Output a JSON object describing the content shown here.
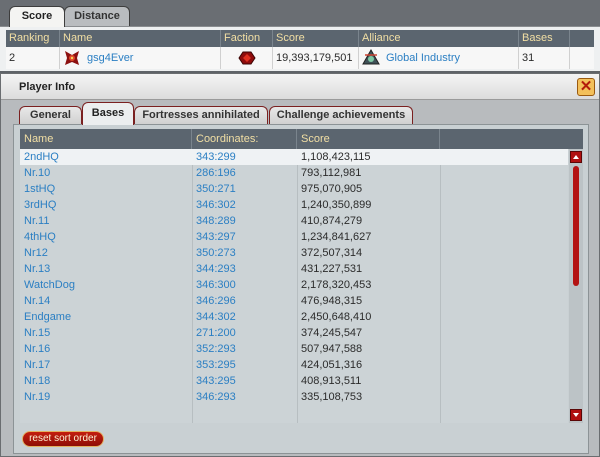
{
  "outer_tabs": [
    {
      "label": "Score",
      "active": true
    },
    {
      "label": "Distance",
      "active": false
    }
  ],
  "ranking": {
    "headers": [
      "Ranking",
      "Name",
      "Faction",
      "Score",
      "Alliance",
      "Bases"
    ],
    "row": {
      "rank": "2",
      "name": "gsg4Ever",
      "faction_icon": "faction-emblem-icon",
      "score": "19,393,179,501",
      "alliance": "Global Industry",
      "bases": "31"
    }
  },
  "player_info": {
    "title": "Player Info",
    "close_icon": "close-icon",
    "tabs": [
      {
        "label": "General",
        "active": false
      },
      {
        "label": "Bases",
        "active": true
      },
      {
        "label": "Fortresses annihilated",
        "active": false
      },
      {
        "label": "Challenge achievements",
        "active": false
      }
    ],
    "columns": [
      "Name",
      "Coordinates:",
      "Score"
    ],
    "bases": [
      {
        "name": "2ndHQ",
        "coords": "343:299",
        "score": "1,108,423,115"
      },
      {
        "name": "Nr.10",
        "coords": "286:196",
        "score": "793,112,981"
      },
      {
        "name": "1stHQ",
        "coords": "350:271",
        "score": "975,070,905"
      },
      {
        "name": "3rdHQ",
        "coords": "346:302",
        "score": "1,240,350,899"
      },
      {
        "name": "Nr.11",
        "coords": "348:289",
        "score": "410,874,279"
      },
      {
        "name": "4thHQ",
        "coords": "343:297",
        "score": "1,234,841,627"
      },
      {
        "name": "Nr12",
        "coords": "350:273",
        "score": "372,507,314"
      },
      {
        "name": "Nr.13",
        "coords": "344:293",
        "score": "431,227,531"
      },
      {
        "name": "WatchDog",
        "coords": "346:300",
        "score": "2,178,320,453"
      },
      {
        "name": "Nr.14",
        "coords": "346:296",
        "score": "476,948,315"
      },
      {
        "name": "Endgame",
        "coords": "344:302",
        "score": "2,450,648,410"
      },
      {
        "name": "Nr.15",
        "coords": "271:200",
        "score": "374,245,547"
      },
      {
        "name": "Nr.16",
        "coords": "352:293",
        "score": "507,947,588"
      },
      {
        "name": "Nr.17",
        "coords": "353:295",
        "score": "424,051,316"
      },
      {
        "name": "Nr.18",
        "coords": "343:295",
        "score": "408,913,511"
      },
      {
        "name": "Nr.19",
        "coords": "346:293",
        "score": "335,108,753"
      }
    ],
    "reset_label": "reset sort order",
    "accent_color": "#b31313"
  }
}
